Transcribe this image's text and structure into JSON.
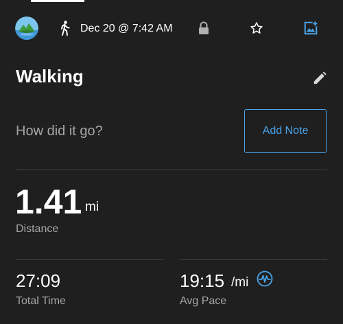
{
  "header": {
    "avatar_icon": "island-avatar-icon",
    "activity_icon": "walking-person-icon",
    "date": "Dec 20 @ 7:42 AM",
    "privacy_icon": "lock-icon",
    "favorite_icon": "star-icon",
    "add_photo_icon": "add-photo-icon"
  },
  "activity": {
    "title": "Walking",
    "edit_icon": "pencil-icon"
  },
  "note": {
    "prompt": "How did it go?",
    "button_label": "Add Note"
  },
  "stats": {
    "distance": {
      "value": "1.41",
      "unit": "mi",
      "label": "Distance"
    },
    "time": {
      "value": "27:09",
      "label": "Total Time"
    },
    "pace": {
      "value": "19:15",
      "unit": "/mi",
      "label": "Avg Pace",
      "icon": "pace-chart-icon"
    }
  },
  "colors": {
    "background": "#1f1f1f",
    "accent": "#4aa3e8",
    "text": "#ffffff",
    "secondary_text": "#a6a6a6"
  }
}
